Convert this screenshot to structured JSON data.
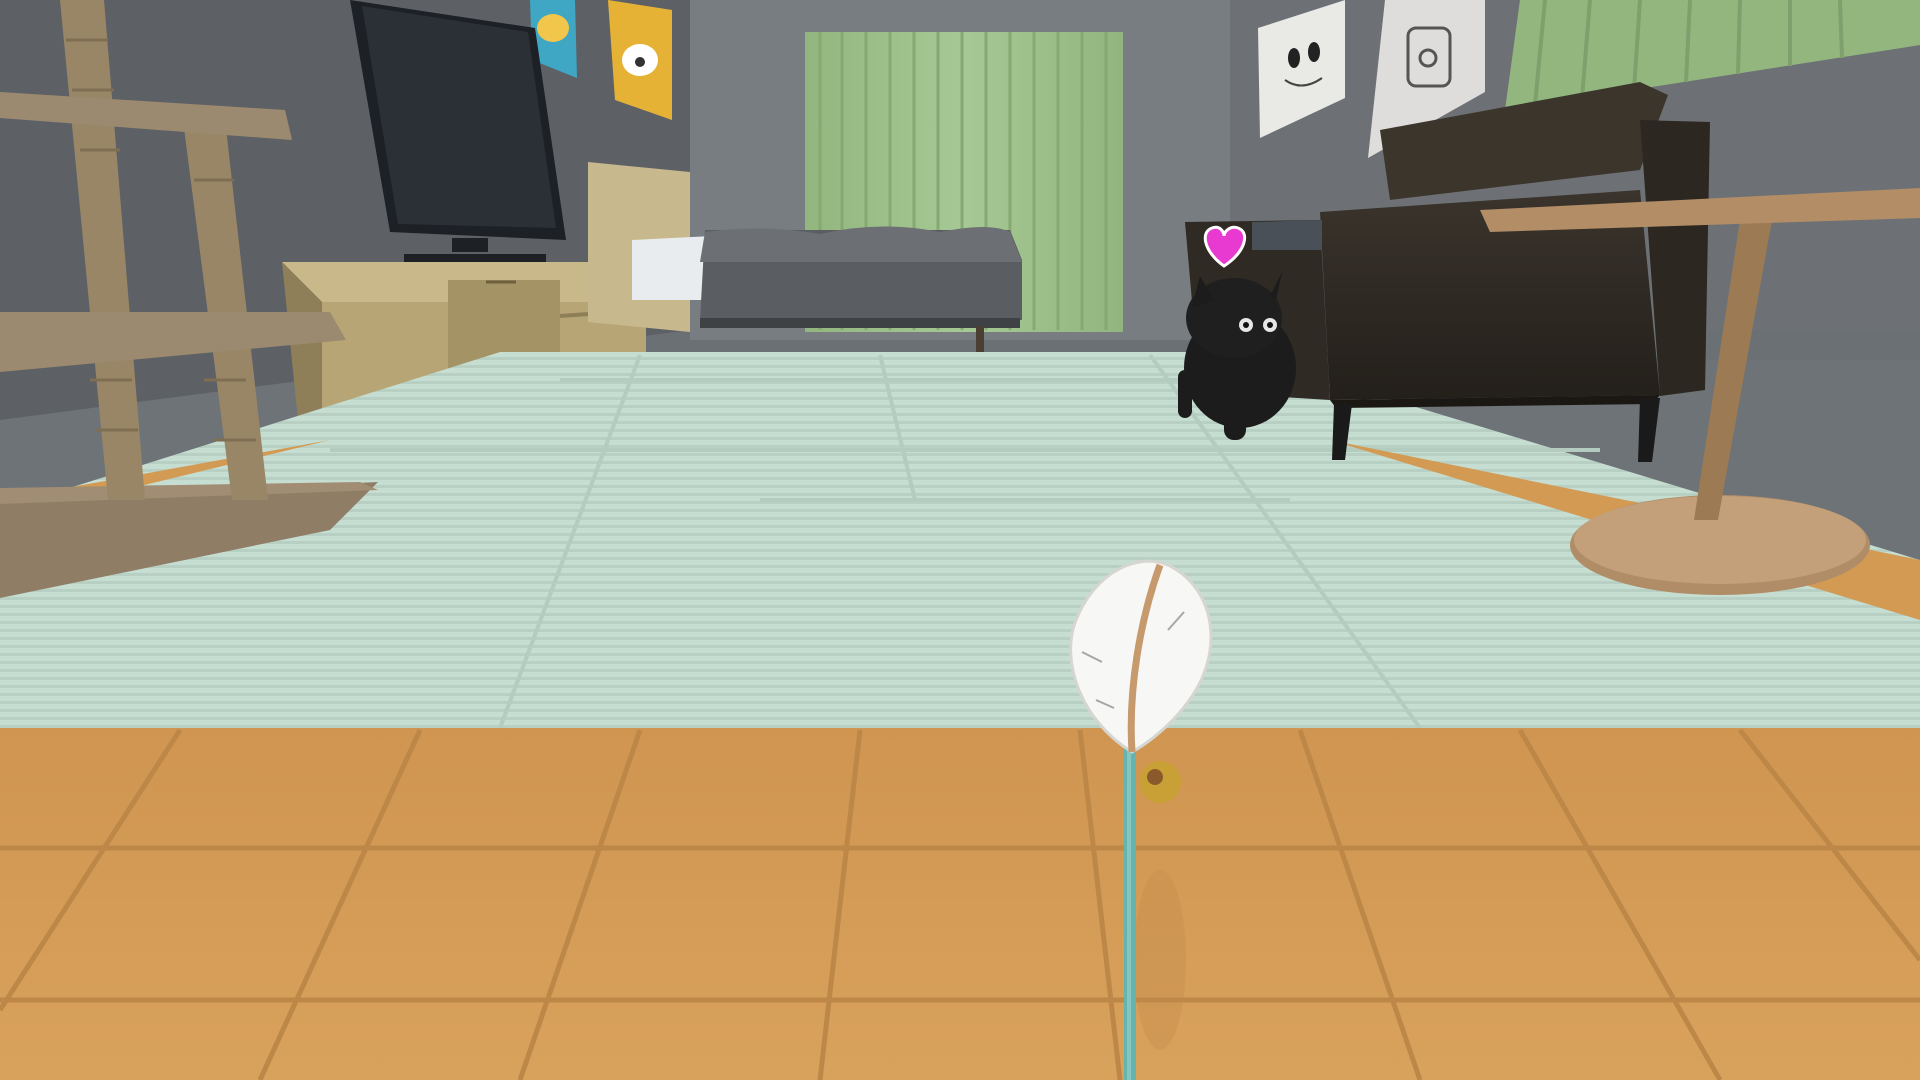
{
  "game": {
    "view": "first-person",
    "scene": "cat-room",
    "held_item": "feather-wand-toy",
    "cat_status_icon": "heart-icon",
    "cat_mood_color": "#e83ad0"
  },
  "colors": {
    "wall": "#6c7075",
    "wall_dark": "#5a5e63",
    "tatami": "#c4dccf",
    "tatami_line": "#a9c6b8",
    "wood_floor": "#d39a54",
    "wood_floor_dark": "#b98244",
    "curtain": "#9fc18b",
    "sofa": "#2f2a24",
    "cat": "#1c1c1c",
    "heart": "#e83ad0",
    "wand": "#67b3ad",
    "bell": "#c9a035"
  }
}
